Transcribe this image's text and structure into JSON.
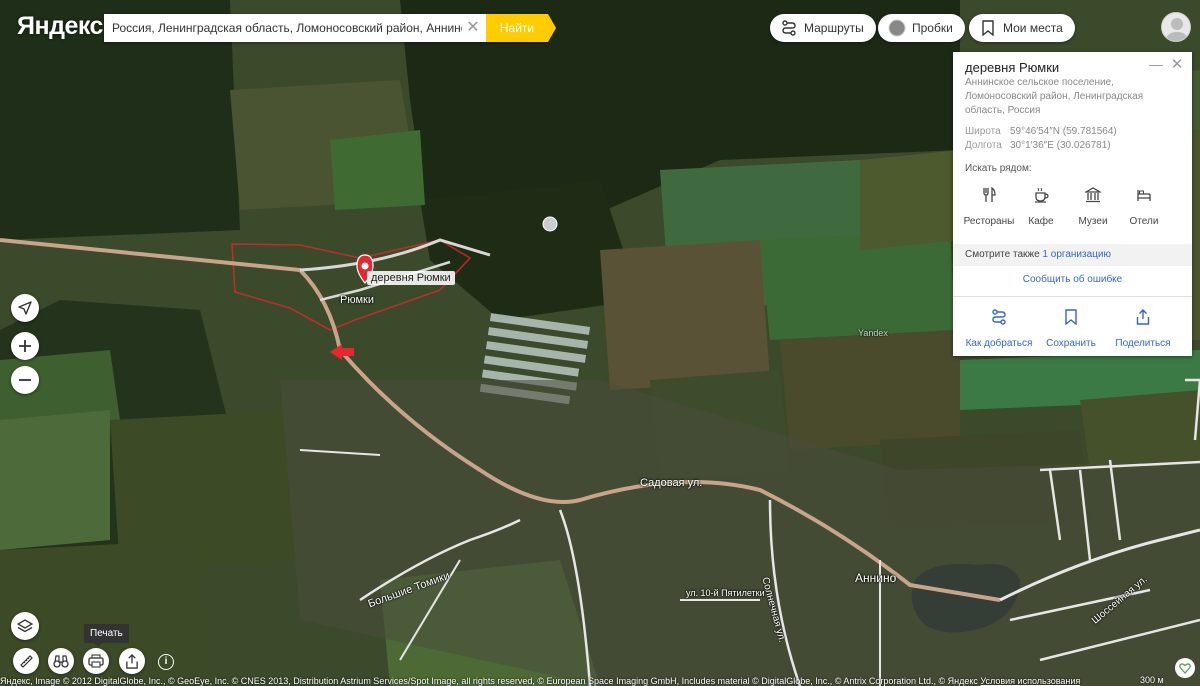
{
  "header": {
    "logo": "Яндекс",
    "search_value": "Россия, Ленинградская область, Ломоносовский район, Аннинское се",
    "search_button": "Найти",
    "routes_label": "Маршруты",
    "traffic_label": "Пробки",
    "places_label": "Мои места"
  },
  "card": {
    "title": "деревня Рюмки",
    "address": "Аннинское сельское поселение, Ломоносовский район, Ленинградская область, Россия",
    "latitude_label": "Широта",
    "latitude_value": "59°46′54″N (59.781564)",
    "longitude_label": "Долгота",
    "longitude_value": "30°1′36″E (30.026781)",
    "nearby_title": "Искать рядом:",
    "nearby": [
      {
        "label": "Рестораны",
        "icon": "fork-knife-icon"
      },
      {
        "label": "Кафе",
        "icon": "coffee-cup-icon"
      },
      {
        "label": "Музеи",
        "icon": "museum-icon"
      },
      {
        "label": "Отели",
        "icon": "bed-icon"
      }
    ],
    "see_also_prefix": "Смотрите также",
    "see_also_link": "1 организацию",
    "report_error": "Сообщить об ошибке",
    "actions": [
      {
        "label": "Как добраться",
        "icon": "route-icon"
      },
      {
        "label": "Сохранить",
        "icon": "bookmark-icon"
      },
      {
        "label": "Поделиться",
        "icon": "share-icon"
      }
    ]
  },
  "map": {
    "pin_label": "деревня Рюмки",
    "labels": {
      "ryumki": "Рюмки",
      "sadovaya": "Садовая ул.",
      "annino": "Аннино",
      "bolshie_tomiki": "Большие Томики",
      "pyatiletki": "ул. 10-й Пятилетки",
      "solnechnaya": "Солнечная ул.",
      "shosseynaya": "Шоссейная ул.",
      "yandex_watermark": "Yandex"
    }
  },
  "controls": {
    "print_tooltip": "Печать"
  },
  "footer": {
    "copyright": "Яндекс, Image © 2012 DigitalGlobe, Inc., © GeoEye, Inc. © CNES 2013, Distribution Astrium Services/Spot Image, all rights reserved, © European Space Imaging GmbH, Includes material © DigitalGlobe, Inc., © Antrix Corporation Ltd., © Яндекс",
    "terms_link": "Условия использования",
    "scale": "300 м"
  },
  "colors": {
    "accent": "#ffcc00",
    "link": "#3366cc",
    "pin": "#e8262f",
    "road": "#c9a48a"
  }
}
